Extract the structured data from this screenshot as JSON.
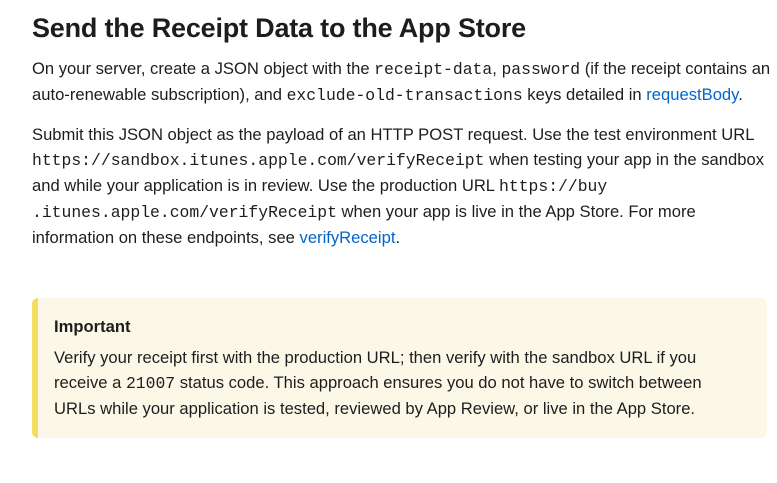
{
  "heading": "Send the Receipt Data to the App Store",
  "para1": {
    "t1": "On your server, create a JSON object with the ",
    "code1": "receipt-data",
    "t2": ", ",
    "code2": "password",
    "t3": " (if the receipt contains an auto-renewable subscription), and ",
    "code3": "exclude-old-transactions",
    "t4": " keys detailed in ",
    "link": "requestBody",
    "t5": "."
  },
  "para2": {
    "t1": "Submit this JSON object as the payload of an HTTP POST request. Use the test environment URL ",
    "code1": "https://sandbox.itunes.apple.com/verifyReceipt",
    "t2": " when testing your app in the sandbox and while your application is in review. Use the production URL ",
    "code2a": "https://buy",
    "code2b": ".itunes.apple.com/verifyReceipt",
    "t3": " when your app is live in the App Store. For more information on these endpoints, see ",
    "link": "verifyReceipt",
    "t4": "."
  },
  "aside": {
    "title": "Important",
    "t1": "Verify your receipt first with the production URL; then verify with the sandbox URL if you receive a ",
    "code": "21007",
    "t2": " status code. This approach ensures you do not have to switch between URLs while your application is tested, reviewed by App Review, or live in the App Store."
  },
  "colors": {
    "link": "#0066cc",
    "aside_background": "#fbf8e8",
    "aside_border": "#f4de62"
  }
}
